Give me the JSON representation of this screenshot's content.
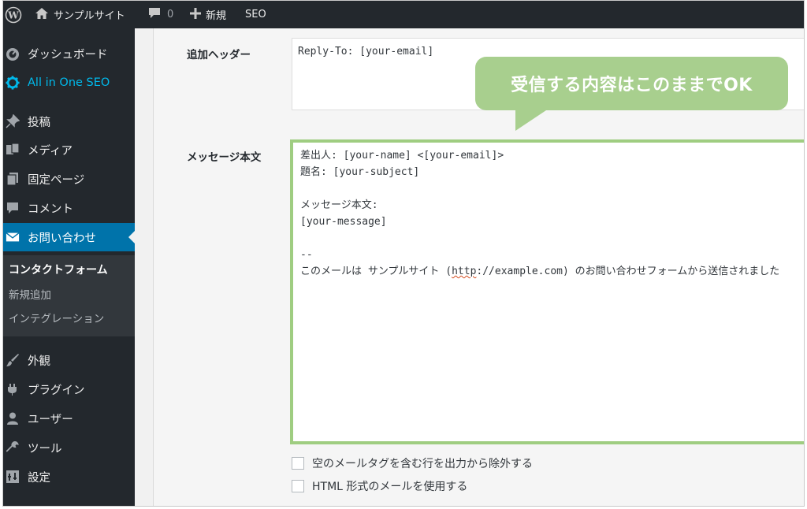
{
  "adminbar": {
    "site_name": "サンプルサイト",
    "comment_count": "0",
    "new_label": "新規",
    "seo_label": "SEO"
  },
  "sidebar": {
    "items": [
      {
        "label": "ダッシュボード",
        "icon": "dashboard-icon"
      },
      {
        "label": "All in One SEO",
        "icon": "gear-icon"
      },
      {
        "label": "投稿",
        "icon": "pin-icon"
      },
      {
        "label": "メディア",
        "icon": "media-icon"
      },
      {
        "label": "固定ページ",
        "icon": "pages-icon"
      },
      {
        "label": "コメント",
        "icon": "comment-icon"
      },
      {
        "label": "お問い合わせ",
        "icon": "mail-icon"
      },
      {
        "label": "外観",
        "icon": "brush-icon"
      },
      {
        "label": "プラグイン",
        "icon": "plugin-icon"
      },
      {
        "label": "ユーザー",
        "icon": "user-icon"
      },
      {
        "label": "ツール",
        "icon": "wrench-icon"
      },
      {
        "label": "設定",
        "icon": "settings-icon"
      }
    ],
    "submenu": [
      "コンタクトフォーム",
      "新規追加",
      "インテグレーション"
    ]
  },
  "form": {
    "header_label": "追加ヘッダー",
    "header_value": "Reply-To: [your-email]",
    "body_label": "メッセージ本文",
    "body_lines": [
      "差出人: [your-name] <[your-email]>",
      "題名: [your-subject]",
      "",
      "メッセージ本文:",
      "[your-message]",
      "",
      "--"
    ],
    "body_last_pre": "このメールは サンプルサイト (",
    "body_last_link": "http",
    "body_last_post": "://example.com) のお問い合わせフォームから送信されました",
    "options": [
      "空のメールタグを含む行を出力から除外する",
      "HTML 形式のメールを使用する"
    ]
  },
  "callout": {
    "text": "受信する内容はこのままでOK"
  },
  "colors": {
    "adminbar_bg": "#23282d",
    "active_blue": "#0073aa",
    "aioseo_cyan": "#00b9eb",
    "highlight_green": "#9fcd81",
    "callout_green": "#a8cf8e"
  }
}
